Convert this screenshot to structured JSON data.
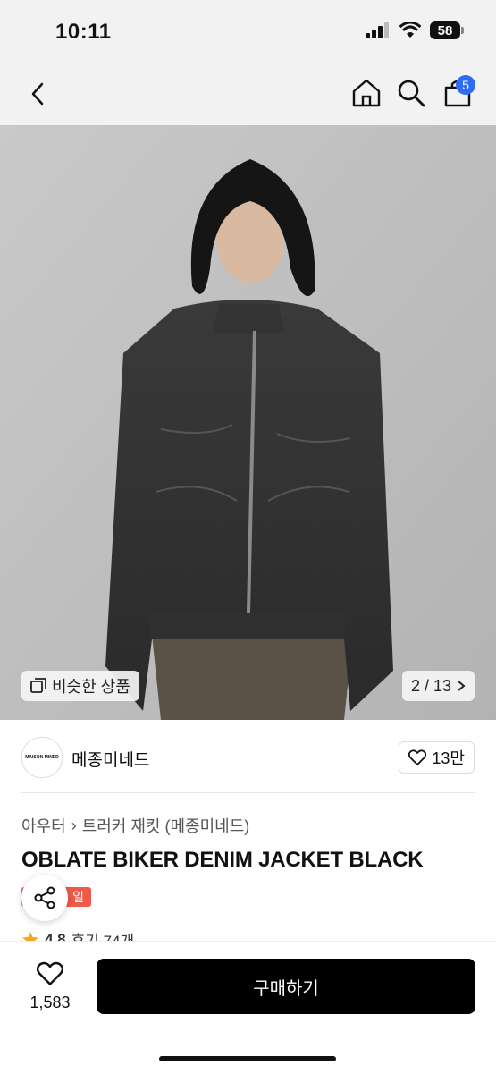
{
  "status_bar": {
    "time": "10:11",
    "battery": "58"
  },
  "nav": {
    "cart_badge": "5"
  },
  "hero": {
    "similar_label": "비슷한 상품",
    "page_indicator": "2 / 13"
  },
  "brand": {
    "logo_text": "MAISON MINED",
    "name": "메종미네드",
    "like_count": "13만"
  },
  "product": {
    "breadcrumb": [
      "아우터",
      "트러커 재킷 (메종미네드)"
    ],
    "title": "OBLATE BIKER DENIM JACKET BLACK",
    "badge": "일",
    "rating": "4.8",
    "reviews": "후기 74개"
  },
  "bottom": {
    "wish_count": "1,583",
    "buy_label": "구매하기"
  },
  "colors": {
    "accent_blue": "#2f6cf6",
    "sale_red": "#ef5a47",
    "buy_black": "#000000"
  }
}
